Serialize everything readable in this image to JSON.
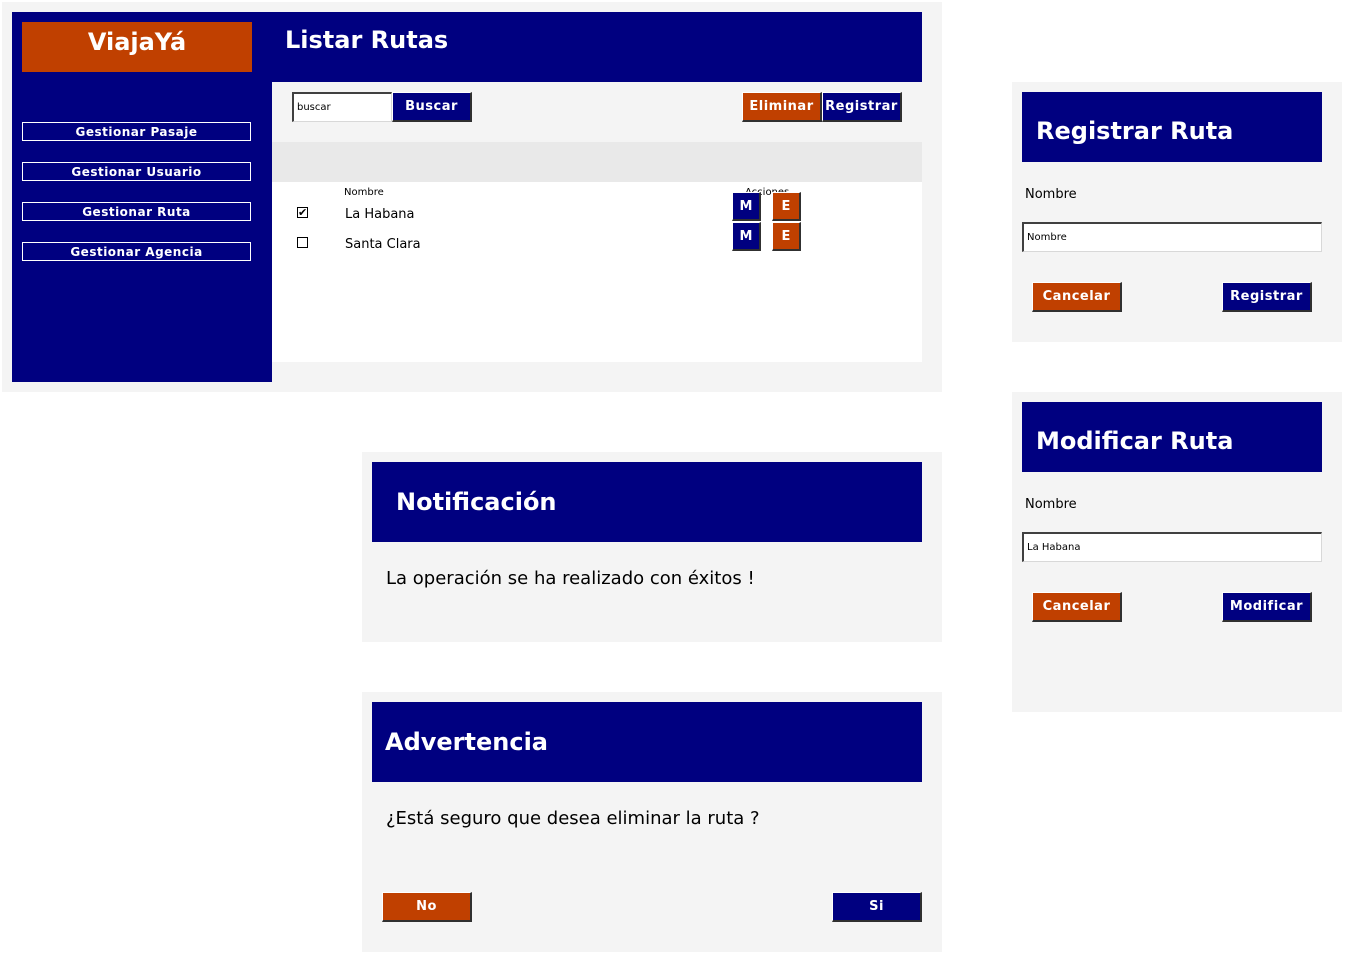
{
  "main": {
    "brand": "ViajaYá",
    "title": "Listar Rutas",
    "sidebar": {
      "items": [
        {
          "label": "Gestionar Pasaje"
        },
        {
          "label": "Gestionar Usuario"
        },
        {
          "label": "Gestionar Ruta"
        },
        {
          "label": "Gestionar Agencia"
        }
      ]
    },
    "toolbar": {
      "search_value": "buscar",
      "search_button": "Buscar",
      "delete_button": "Eliminar",
      "register_button": "Registrar"
    },
    "table": {
      "col_name": "Nombre",
      "col_actions": "Acciones",
      "rows": [
        {
          "name": "La Habana",
          "checked": "✔",
          "modify": "M",
          "delete": "E"
        },
        {
          "name": "Santa Clara",
          "checked": "",
          "modify": "M",
          "delete": "E"
        }
      ]
    }
  },
  "register_dialog": {
    "title": "Registrar Ruta",
    "field_label": "Nombre",
    "field_value": "Nombre",
    "cancel": "Cancelar",
    "submit": "Registrar"
  },
  "modify_dialog": {
    "title": "Modificar Ruta",
    "field_label": "Nombre",
    "field_value": "La Habana",
    "cancel": "Cancelar",
    "submit": "Modificar"
  },
  "notification_dialog": {
    "title": "Notificación",
    "message": "La operación se ha realizado con éxitos !"
  },
  "warning_dialog": {
    "title": "Advertencia",
    "message": "¿Está seguro que desea eliminar la ruta ?",
    "no": "No",
    "yes": "Si"
  },
  "colors": {
    "navy": "#000080",
    "orange": "#c04000",
    "panel": "#f4f4f4"
  }
}
